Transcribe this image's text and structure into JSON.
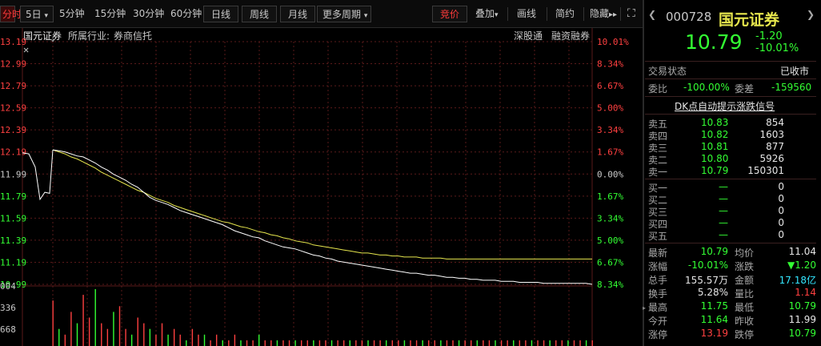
{
  "toolbar": {
    "left_tab": "分时",
    "period_5d": "5日",
    "period_5d_arrow": "▾",
    "periods": [
      "5分钟",
      "15分钟",
      "30分钟",
      "60分钟",
      "日线",
      "周线",
      "月线"
    ],
    "more_periods": "更多周期",
    "more_arrow": "▾",
    "right_buttons": [
      "竞价",
      "叠加",
      "画线",
      "简约",
      "隐藏"
    ],
    "overlay_arrow": "▾",
    "hide_arrow": "▸▸",
    "fullscreen_icon": "⛶"
  },
  "chart_header": {
    "stock_name": "国元证券",
    "industry_label": "所属行业:",
    "industry_value": "券商信托",
    "flags": [
      "深股通",
      "融资融券"
    ]
  },
  "colors": {
    "red": "#ff4040",
    "green": "#33ff33",
    "price_line": "#ffffff",
    "avg_line": "#e6e64d",
    "grid": "#5a1a1a"
  },
  "chart_data": {
    "type": "line",
    "series": [
      {
        "name": "价格",
        "values": [
          12.12,
          12.11,
          12.1,
          12.08,
          12.06,
          12.05,
          12.02,
          11.99,
          11.95,
          11.92,
          11.88,
          11.85,
          11.82,
          11.78,
          11.75,
          11.7,
          11.65,
          11.62,
          11.6,
          11.58,
          11.55,
          11.52,
          11.5,
          11.48,
          11.46,
          11.44,
          11.42,
          11.4,
          11.38,
          11.35,
          11.32,
          11.3,
          11.28,
          11.26,
          11.25,
          11.22,
          11.2,
          11.18,
          11.16,
          11.15,
          11.14,
          11.12,
          11.1,
          11.08,
          11.07,
          11.05,
          11.04,
          11.02,
          11.01,
          11.0,
          10.99,
          10.98,
          10.97,
          10.96,
          10.95,
          10.94,
          10.93,
          10.92,
          10.91,
          10.9,
          10.9,
          10.89,
          10.88,
          10.88,
          10.87,
          10.86,
          10.86,
          10.85,
          10.85,
          10.84,
          10.84,
          10.83,
          10.83,
          10.83,
          10.82,
          10.82,
          10.82,
          10.81,
          10.81,
          10.81,
          10.81,
          10.8,
          10.8,
          10.8,
          10.8,
          10.8,
          10.8,
          10.8,
          10.8,
          10.79
        ]
      },
      {
        "name": "均价",
        "values": [
          12.12,
          12.1,
          12.08,
          12.05,
          12.03,
          12.0,
          11.97,
          11.94,
          11.9,
          11.87,
          11.84,
          11.81,
          11.78,
          11.75,
          11.72,
          11.7,
          11.67,
          11.64,
          11.62,
          11.6,
          11.57,
          11.55,
          11.53,
          11.51,
          11.49,
          11.47,
          11.45,
          11.43,
          11.41,
          11.4,
          11.38,
          11.36,
          11.35,
          11.33,
          11.31,
          11.3,
          11.28,
          11.27,
          11.25,
          11.24,
          11.22,
          11.21,
          11.2,
          11.18,
          11.17,
          11.16,
          11.15,
          11.14,
          11.13,
          11.12,
          11.11,
          11.1,
          11.1,
          11.09,
          11.08,
          11.08,
          11.07,
          11.07,
          11.06,
          11.06,
          11.06,
          11.05,
          11.05,
          11.05,
          11.05,
          11.04,
          11.04,
          11.04,
          11.04,
          11.04,
          11.04,
          11.04,
          11.04,
          11.04,
          11.04,
          11.04,
          11.04,
          11.04,
          11.04,
          11.04,
          11.04,
          11.04,
          11.04,
          11.04,
          11.04,
          11.04,
          11.04,
          11.04,
          11.04,
          11.04
        ]
      },
      {
        "name": "成交量",
        "values": [
          8,
          3,
          2,
          6,
          4,
          9,
          5,
          10,
          4,
          3,
          6,
          7,
          3,
          2,
          5,
          4,
          3,
          2,
          4,
          2,
          3,
          2,
          1,
          3,
          2,
          2,
          1,
          2,
          1,
          1,
          2,
          1,
          1,
          1,
          2,
          1,
          1,
          1,
          1,
          1,
          1,
          1,
          1,
          1,
          1,
          1,
          1,
          1,
          1,
          1,
          1,
          1,
          1,
          1,
          1,
          1,
          1,
          1,
          1,
          1,
          1,
          1,
          1,
          1,
          1,
          1,
          1,
          1,
          1,
          1,
          1,
          1,
          1,
          1,
          1,
          1,
          1,
          1,
          1,
          1,
          1,
          1,
          1,
          1,
          1,
          1,
          1,
          1,
          1,
          1
        ]
      }
    ],
    "ylim": [
      10.79,
      13.19
    ],
    "y_ticks": [
      "13.19",
      "12.99",
      "12.79",
      "12.59",
      "12.39",
      "12.19",
      "11.99",
      "11.79",
      "11.59",
      "11.39",
      "11.19",
      "10.99"
    ],
    "pct_ticks": [
      "10.01%",
      "8.34%",
      "6.67%",
      "5.00%",
      "3.34%",
      "1.67%",
      "0.00%",
      "1.67%",
      "3.34%",
      "5.00%",
      "6.67%",
      "8.34%"
    ],
    "vol_ticks": [
      "004",
      "336",
      "668"
    ],
    "grid": true
  },
  "sidebar": {
    "code": "000728",
    "name": "国元证券",
    "price": "10.79",
    "change": "-1.20",
    "change_pct": "-10.01%",
    "trade_status_label": "交易状态",
    "trade_status_value": "已收市",
    "wb_label": "委比",
    "wb_value": "-100.00%",
    "wc_label": "委差",
    "wc_value": "-159560",
    "dk_link": "DK点自动提示涨跌信号",
    "asks": [
      {
        "label": "卖五",
        "price": "10.83",
        "vol": "854"
      },
      {
        "label": "卖四",
        "price": "10.82",
        "vol": "1603"
      },
      {
        "label": "卖三",
        "price": "10.81",
        "vol": "877"
      },
      {
        "label": "卖二",
        "price": "10.80",
        "vol": "5926"
      },
      {
        "label": "卖一",
        "price": "10.79",
        "vol": "150301"
      }
    ],
    "bids": [
      {
        "label": "买一",
        "price": "—",
        "vol": "0"
      },
      {
        "label": "买二",
        "price": "—",
        "vol": "0"
      },
      {
        "label": "买三",
        "price": "—",
        "vol": "0"
      },
      {
        "label": "买四",
        "price": "—",
        "vol": "0"
      },
      {
        "label": "买五",
        "price": "—",
        "vol": "0"
      }
    ],
    "stats": [
      {
        "l1": "最新",
        "v1": "10.79",
        "c1": "green",
        "l2": "均价",
        "v2": "11.04",
        "c2": "white"
      },
      {
        "l1": "涨幅",
        "v1": "-10.01%",
        "c1": "green",
        "l2": "涨跌",
        "v2": "▼1.20",
        "c2": "green"
      },
      {
        "l1": "总手",
        "v1": "155.57万",
        "c1": "white",
        "l2": "金额",
        "v2": "17.18亿",
        "c2": "cyan"
      },
      {
        "l1": "换手",
        "v1": "5.28%",
        "c1": "white",
        "l2": "量比",
        "v2": "1.14",
        "c2": "red"
      },
      {
        "l1": "最高",
        "v1": "11.75",
        "c1": "green",
        "l2": "最低",
        "v2": "10.79",
        "c2": "green"
      },
      {
        "l1": "今开",
        "v1": "11.64",
        "c1": "green",
        "l2": "昨收",
        "v2": "11.99",
        "c2": "white"
      },
      {
        "l1": "涨停",
        "v1": "13.19",
        "c1": "red",
        "l2": "跌停",
        "v2": "10.79",
        "c2": "green"
      }
    ]
  }
}
